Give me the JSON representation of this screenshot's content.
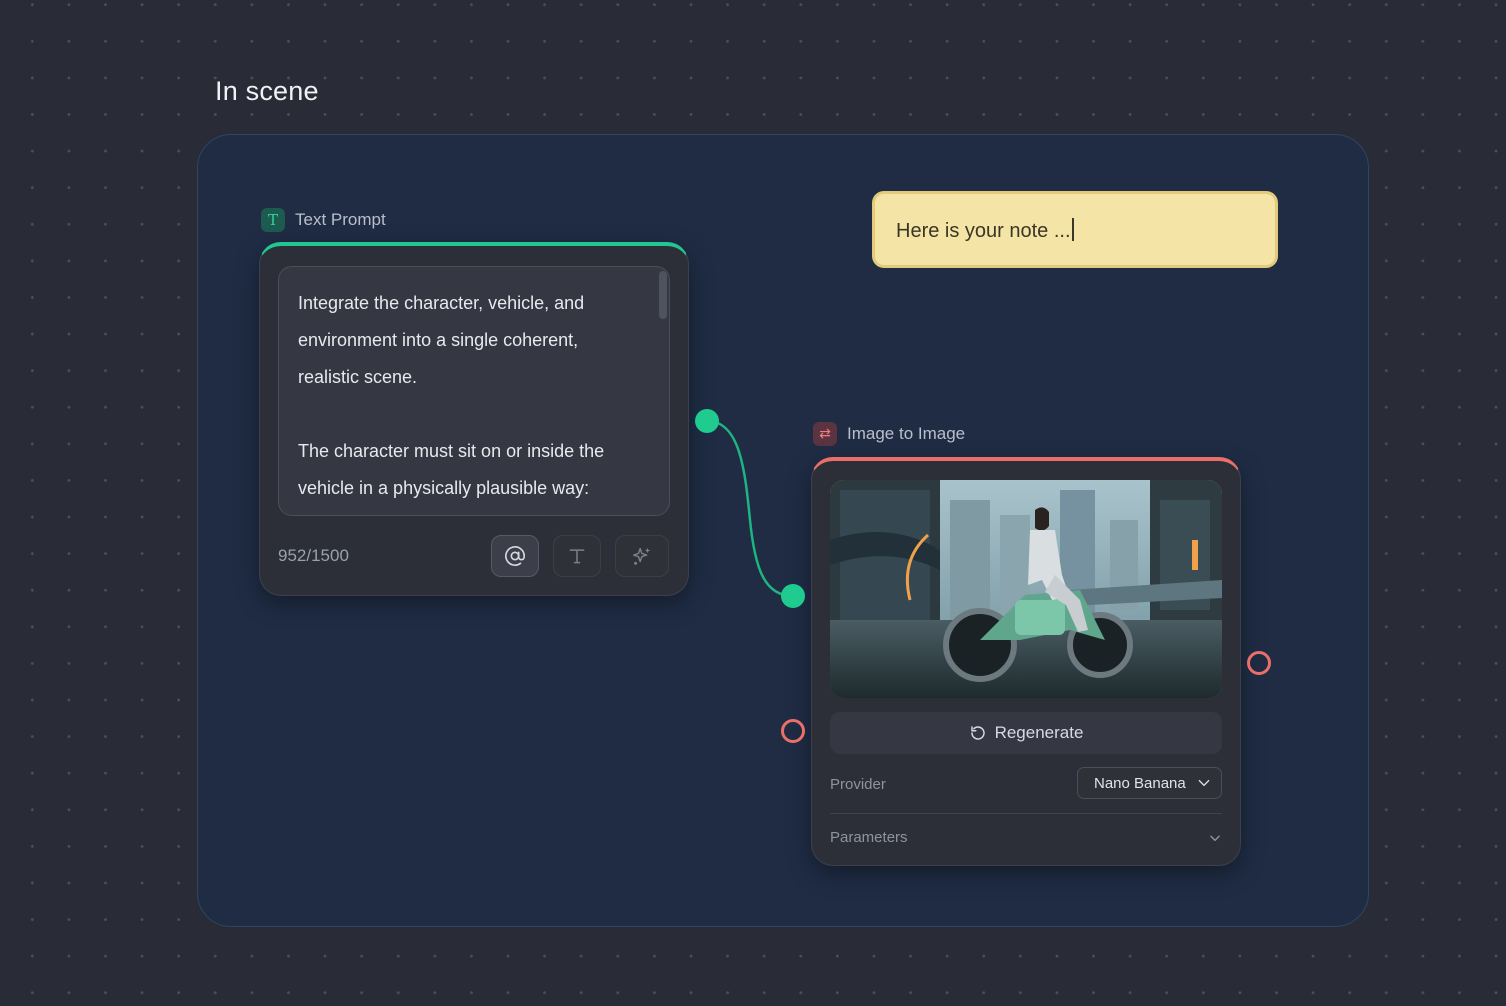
{
  "group": {
    "title": "In scene"
  },
  "text_prompt": {
    "header": "Text Prompt",
    "header_icon": "T",
    "prompt": "Integrate the character, vehicle, and environment into a single coherent, realistic scene.\n\nThe character must sit on or inside the vehicle in a physically plausible way:\n• Hands correctly placed on the controls",
    "char_count": "952/1500",
    "accent_color": "#23c590",
    "tools": [
      "at-sign-icon",
      "text-icon",
      "sparkle-icon"
    ]
  },
  "note": {
    "text": "Here is your note ..."
  },
  "image_to_image": {
    "header": "Image to Image",
    "header_icon": "⇄",
    "accent_color": "#ea6f69",
    "regenerate_label": "Regenerate",
    "provider_label": "Provider",
    "provider_value": "Nano Banana",
    "parameters_label": "Parameters"
  }
}
